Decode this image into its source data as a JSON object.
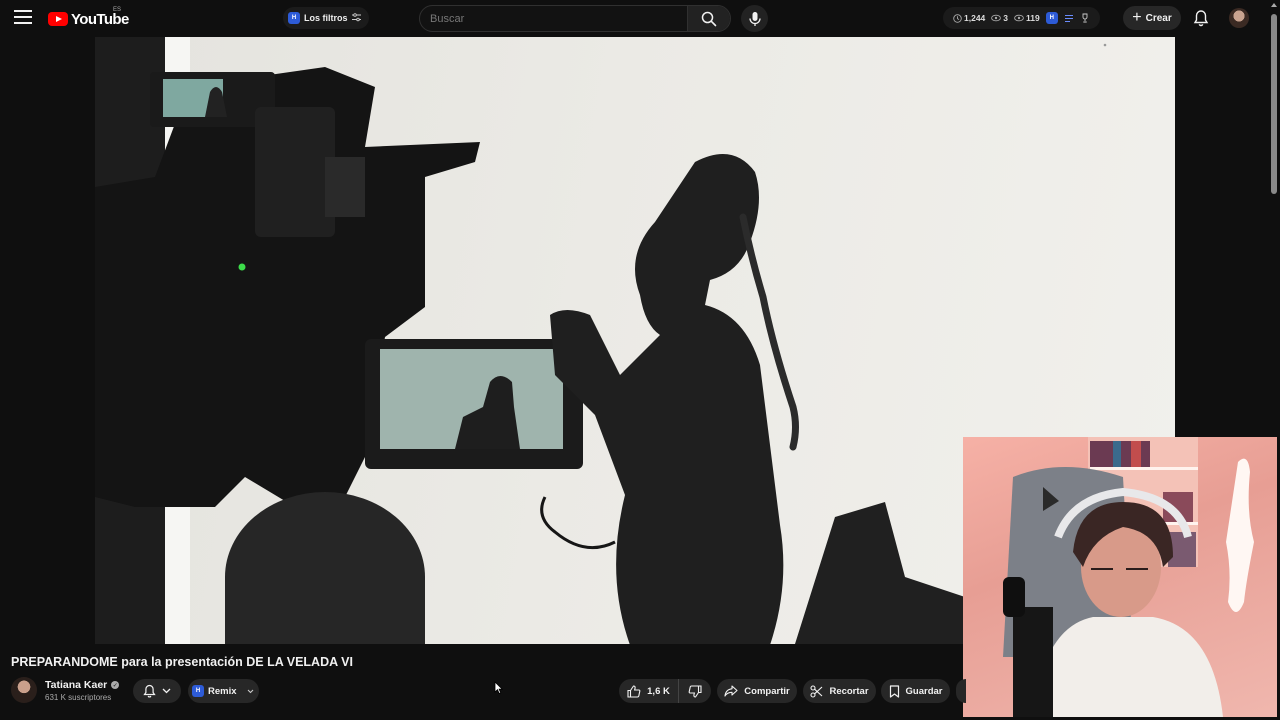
{
  "app": {
    "name": "YouTube",
    "region": "ES"
  },
  "header": {
    "filters_label": "Los filtros",
    "search_placeholder": "Buscar",
    "stats": {
      "watched": "1,244",
      "count_a": "3",
      "count_b": "119"
    },
    "create_label": "Crear"
  },
  "video": {
    "title": "PREPARANDOME para la presentación DE LA VELADA VI"
  },
  "channel": {
    "name": "Tatiana Kaer",
    "subscribers": "631 K suscriptores"
  },
  "actions": {
    "remix_label": "Remix",
    "likes": "1,6 K",
    "share_label": "Compartir",
    "clip_label": "Recortar",
    "save_label": "Guardar"
  },
  "colors": {
    "background": "#0f0f0f",
    "pill": "#272727",
    "brand_red": "#ff0000",
    "extension_blue": "#2d5bd7"
  },
  "icons": [
    "menu-icon",
    "youtube-logo-icon",
    "tune-icon",
    "search-icon",
    "mic-icon",
    "clock-icon",
    "eye-icon",
    "list-icon",
    "trophy-icon",
    "plus-icon",
    "bell-icon",
    "verified-icon",
    "chevron-down-icon",
    "like-icon",
    "dislike-icon",
    "share-icon",
    "scissors-icon",
    "bookmark-icon",
    "cursor-icon"
  ]
}
